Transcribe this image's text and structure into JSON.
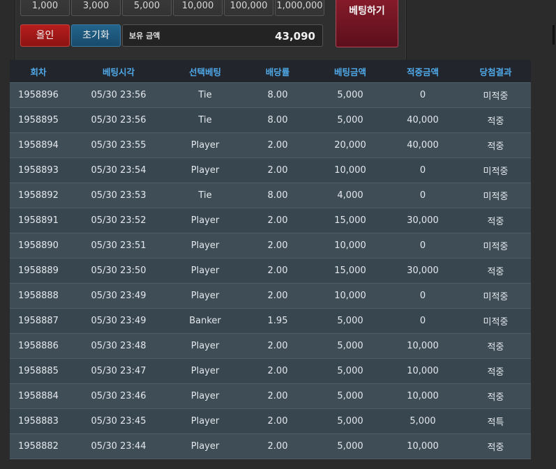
{
  "chips": [
    "1,000",
    "3,000",
    "5,000",
    "10,000",
    "100,000",
    "1,000,000"
  ],
  "controls": {
    "allin_label": "올인",
    "reset_label": "초기화",
    "balance_label": "보유 금액",
    "balance_value": "43,090",
    "bet_label": "베팅하기"
  },
  "table": {
    "headers": [
      "회차",
      "베팅시각",
      "선택베팅",
      "배당률",
      "베팅금액",
      "적중금액",
      "당첨결과"
    ],
    "rows": [
      [
        "1958896",
        "05/30 23:56",
        "Tie",
        "8.00",
        "5,000",
        "0",
        "미적중"
      ],
      [
        "1958895",
        "05/30 23:56",
        "Tie",
        "8.00",
        "5,000",
        "40,000",
        "적중"
      ],
      [
        "1958894",
        "05/30 23:55",
        "Player",
        "2.00",
        "20,000",
        "40,000",
        "적중"
      ],
      [
        "1958893",
        "05/30 23:54",
        "Player",
        "2.00",
        "10,000",
        "0",
        "미적중"
      ],
      [
        "1958892",
        "05/30 23:53",
        "Tie",
        "8.00",
        "4,000",
        "0",
        "미적중"
      ],
      [
        "1958891",
        "05/30 23:52",
        "Player",
        "2.00",
        "15,000",
        "30,000",
        "적중"
      ],
      [
        "1958890",
        "05/30 23:51",
        "Player",
        "2.00",
        "10,000",
        "0",
        "미적중"
      ],
      [
        "1958889",
        "05/30 23:50",
        "Player",
        "2.00",
        "15,000",
        "30,000",
        "적중"
      ],
      [
        "1958888",
        "05/30 23:49",
        "Player",
        "2.00",
        "10,000",
        "0",
        "미적중"
      ],
      [
        "1958887",
        "05/30 23:49",
        "Banker",
        "1.95",
        "5,000",
        "0",
        "미적중"
      ],
      [
        "1958886",
        "05/30 23:48",
        "Player",
        "2.00",
        "5,000",
        "10,000",
        "적중"
      ],
      [
        "1958885",
        "05/30 23:47",
        "Player",
        "2.00",
        "5,000",
        "10,000",
        "적중"
      ],
      [
        "1958884",
        "05/30 23:46",
        "Player",
        "2.00",
        "5,000",
        "10,000",
        "적중"
      ],
      [
        "1958883",
        "05/30 23:45",
        "Player",
        "2.00",
        "5,000",
        "5,000",
        "적특"
      ],
      [
        "1958882",
        "05/30 23:44",
        "Player",
        "2.00",
        "5,000",
        "10,000",
        "적중"
      ]
    ]
  },
  "colors": {
    "header_text": "#4fa8e8",
    "loss": "#e4393c",
    "win": "#f0a437"
  }
}
